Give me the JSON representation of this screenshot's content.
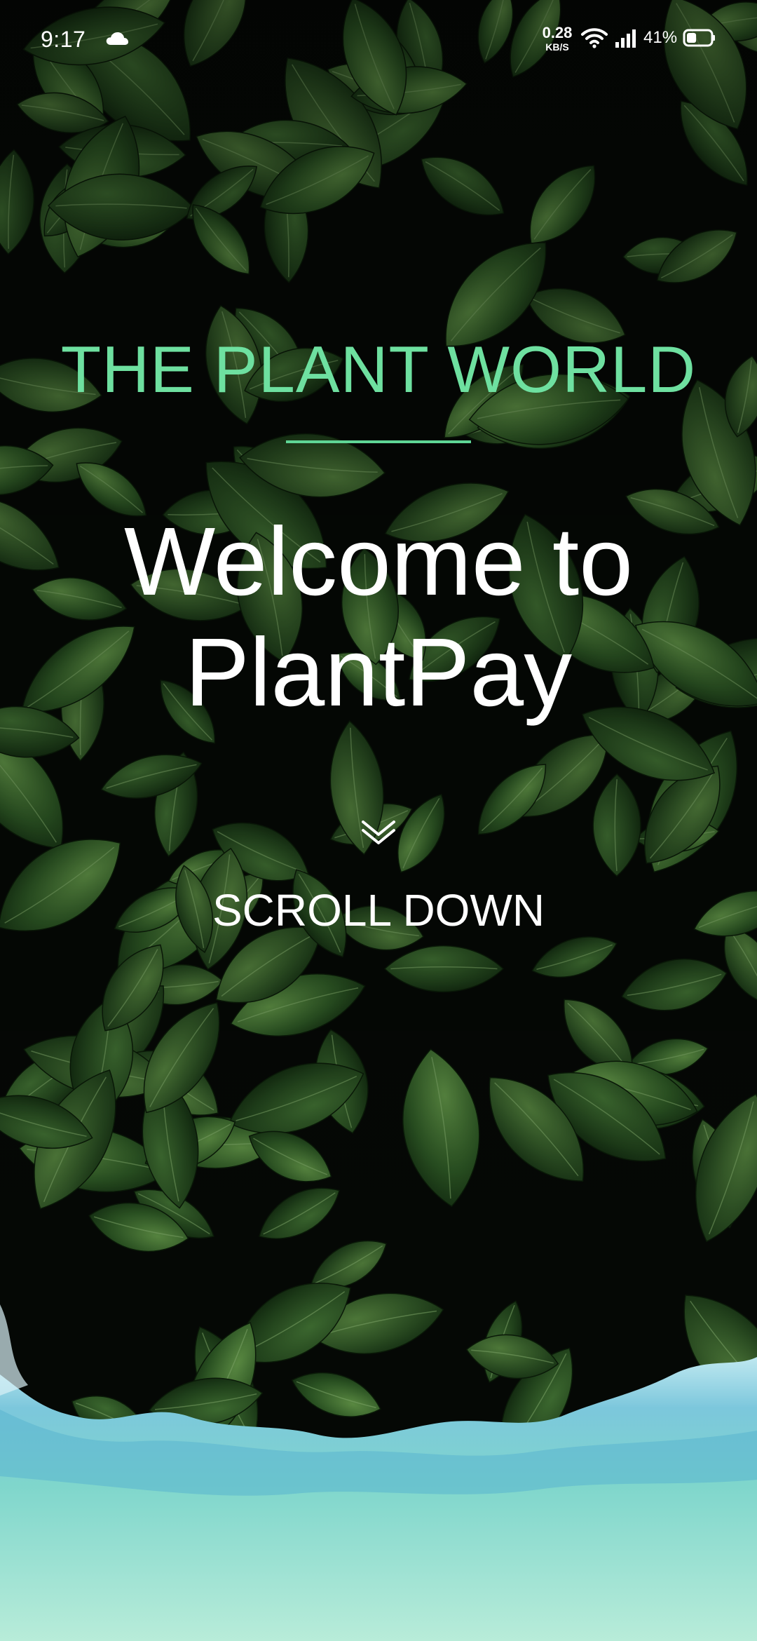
{
  "status_bar": {
    "time": "9:17",
    "net_speed_value": "0.28",
    "net_speed_unit": "KB/S",
    "battery_percent": "41%"
  },
  "hero": {
    "brand": "THE PLANT WORLD",
    "welcome_line1": "Welcome to",
    "welcome_line2": "PlantPay",
    "scroll_label": "SCROLL DOWN"
  },
  "icons": {
    "cloud": "cloud-icon",
    "wifi": "wifi-icon",
    "signal": "signal-icon",
    "battery": "battery-icon",
    "chevron": "double-chevron-down-icon"
  },
  "colors": {
    "brand_green": "#6ee0a0",
    "divider_green": "#5fd595",
    "text_white": "#ffffff",
    "background_dark": "#060806",
    "water_teal": "#7fd6cc"
  },
  "battery_level": 0.41
}
